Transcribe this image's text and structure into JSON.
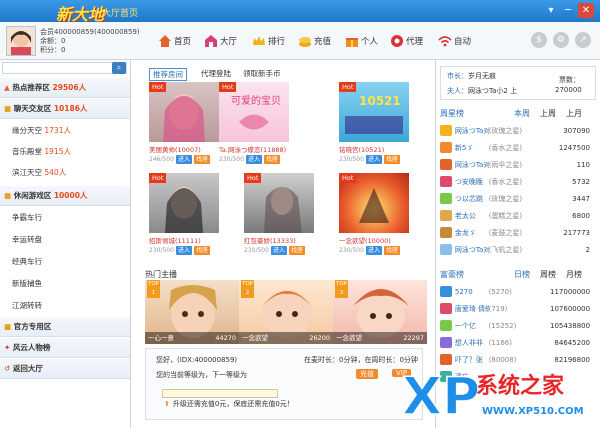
{
  "titlebar": {
    "logo": "新大地",
    "hall_link": "大厅首页"
  },
  "user": {
    "account": "会员400000859(400000859)",
    "balance": "余额：0",
    "points": "积分：0"
  },
  "nav": [
    {
      "label": "首页"
    },
    {
      "label": "大厅"
    },
    {
      "label": "排行"
    },
    {
      "label": "充值"
    },
    {
      "label": "个人"
    },
    {
      "label": "代理"
    },
    {
      "label": "自动"
    }
  ],
  "sidebar": {
    "categories": [
      {
        "label": "热点推荐区",
        "count": "29506人"
      },
      {
        "label": "聊天交友区",
        "count": "10186人"
      },
      {
        "label": "休闲游戏区",
        "count": "10000人"
      },
      {
        "label": "官方专用区",
        "count": ""
      },
      {
        "label": "风云人物榜",
        "count": ""
      },
      {
        "label": "返回大厅",
        "count": ""
      }
    ],
    "chat_items": [
      {
        "label": "缘分天空",
        "count": "1731人"
      },
      {
        "label": "音乐殿堂",
        "count": "1915人"
      },
      {
        "label": "滨江天空",
        "count": "540人"
      }
    ],
    "game_items": [
      "争霸车行",
      "幸运转盘",
      "经典车行",
      "新版捕鱼",
      "江湖转转"
    ]
  },
  "tabs": [
    "推荐房间",
    "代理登陆",
    "领取新手币"
  ],
  "rooms": [
    {
      "name": "美丽黄帅(10007)",
      "count": "246/500",
      "in": "进入",
      "seat": "找座",
      "label": "Hot"
    },
    {
      "name": "Ta.网泳つ蝶恋(11888)",
      "count": "230/500",
      "in": "进入",
      "seat": "找座",
      "label": "Hot",
      "banner": "可爱的宝贝"
    },
    {
      "name": "铭晓宫(10521)",
      "count": "230/500",
      "in": "进入",
      "seat": "找座",
      "label": "Hot",
      "banner": "10521"
    },
    {
      "name": "招斯倾城(11111)",
      "count": "230/500",
      "in": "进入",
      "seat": "找座",
      "label": "Hot"
    },
    {
      "name": "红包豪娇(13333)",
      "count": "230/500",
      "in": "进入",
      "seat": "找座",
      "label": "Hot"
    },
    {
      "name": "一念欲望(10000)",
      "count": "230/500",
      "in": "进入",
      "seat": "找座",
      "label": "Hot"
    }
  ],
  "hot_hosts": {
    "title": "热门主播",
    "items": [
      {
        "rank": "TOP 1",
        "name": "一心一意",
        "fans": "44270"
      },
      {
        "rank": "TOP 2",
        "name": "一念欲望",
        "fans": "26200"
      },
      {
        "rank": "TOP 3",
        "name": "一念欲望",
        "fans": "22297"
      }
    ]
  },
  "infobox": {
    "hello": "您好，(IDX:400000859)",
    "online": "在麦时长：0分钟，在周时长：0分钟",
    "level": "您的当前等级为，下一等级为",
    "upgrade": "升级还需充值0元，保底还需充值0元！",
    "btn1": "充值",
    "btn2": "VIP"
  },
  "right": {
    "stat": {
      "city_label": "市长：",
      "city": "岁月无痕",
      "husband_label": "夫人：",
      "husband": "网泳つTa小2 上",
      "total_label": "票数：",
      "total": "270000"
    },
    "week": {
      "title": "周星榜",
      "tabs": [
        "本周",
        "上周",
        "上月"
      ],
      "rows": [
        {
          "name": "网泳つTa对",
          "sub": "(玫瑰之星)",
          "val": "307090"
        },
        {
          "name": "新5ゞ",
          "sub": "(香水之星)",
          "val": "1247500"
        },
        {
          "name": "网泳つTa对",
          "sub": "(雨伞之星)",
          "val": "110"
        },
        {
          "name": "つ安晚晚",
          "sub": "(香水之星)",
          "val": "5732"
        },
        {
          "name": "つ以芯跳",
          "sub": "(玫瑰之星)",
          "val": "3447"
        },
        {
          "name": "老太公",
          "sub": "(蛋糕之星)",
          "val": "6800"
        },
        {
          "name": "金龙ゞ",
          "sub": "(麦鼓之星)",
          "val": "217773"
        },
        {
          "name": "网泳つTa对",
          "sub": "(飞机之星)",
          "val": "2"
        }
      ]
    },
    "rich": {
      "title": "富豪榜",
      "tabs": [
        "日榜",
        "周榜",
        "月榜"
      ],
      "rows": [
        {
          "name": "5270",
          "sub": "(5270)",
          "val": "117000000"
        },
        {
          "name": "唐爱琦 倩蝶",
          "sub": "(719)",
          "val": "107600000"
        },
        {
          "name": "一个亿",
          "sub": "(15252)",
          "val": "105438800"
        },
        {
          "name": "想人非非",
          "sub": "(1166)",
          "val": "84645200"
        },
        {
          "name": "吓了？张",
          "sub": "(80008)",
          "val": "82196800"
        },
        {
          "name": "遗忘",
          "sub": "",
          "val": ""
        }
      ]
    }
  },
  "watermark": {
    "brand": "系统之家",
    "url": "WWW.XP510.COM"
  },
  "colors": {
    "accent": "#2c70b8",
    "hot": "#e53b1b",
    "titlebar": "#2a86d8"
  }
}
